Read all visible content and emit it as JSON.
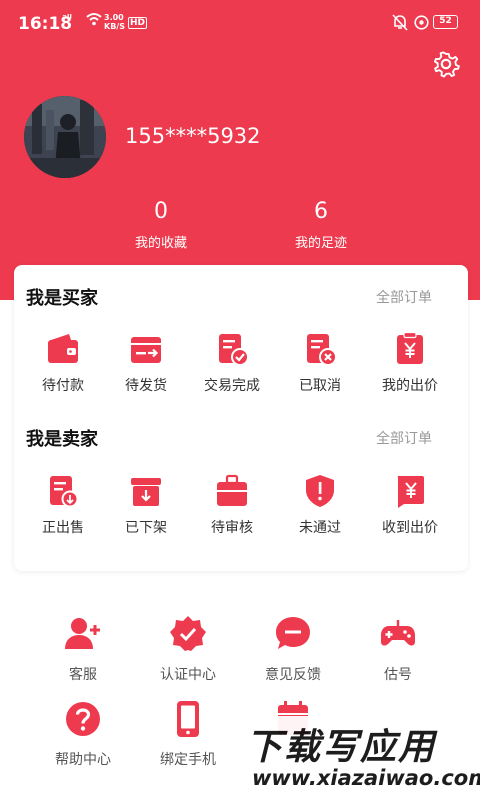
{
  "status_bar": {
    "time": "16:18",
    "signal": "ᵃˡˡ",
    "net_speed_value": "3.00",
    "net_speed_unit": "KB/S",
    "hd": "HD",
    "battery": "52"
  },
  "theme": {
    "accent": "#ee3a4e",
    "card_bg": "#ffffff",
    "muted_text": "#999999"
  },
  "profile": {
    "phone": "155****5932",
    "stats": [
      {
        "value": "0",
        "label": "我的收藏"
      },
      {
        "value": "6",
        "label": "我的足迹"
      }
    ]
  },
  "buyer": {
    "title": "我是买家",
    "all_orders": "全部订单",
    "items": [
      {
        "label": "待付款",
        "icon": "wallet-icon"
      },
      {
        "label": "待发货",
        "icon": "shipping-box-icon"
      },
      {
        "label": "交易完成",
        "icon": "document-check-icon"
      },
      {
        "label": "已取消",
        "icon": "document-cancel-icon"
      },
      {
        "label": "我的出价",
        "icon": "yen-clipboard-icon"
      }
    ]
  },
  "seller": {
    "title": "我是卖家",
    "all_orders": "全部订单",
    "items": [
      {
        "label": "正出售",
        "icon": "document-coin-icon"
      },
      {
        "label": "已下架",
        "icon": "archive-down-icon"
      },
      {
        "label": "待审核",
        "icon": "briefcase-icon"
      },
      {
        "label": "未通过",
        "icon": "shield-alert-icon"
      },
      {
        "label": "收到出价",
        "icon": "yen-tag-icon"
      }
    ]
  },
  "tools": [
    {
      "label": "客服",
      "icon": "user-add-icon"
    },
    {
      "label": "认证中心",
      "icon": "verified-badge-icon"
    },
    {
      "label": "意见反馈",
      "icon": "chat-bubble-icon"
    },
    {
      "label": "估号",
      "icon": "gamepad-icon"
    },
    {
      "label": "帮助中心",
      "icon": "help-circle-icon"
    },
    {
      "label": "绑定手机",
      "icon": "phone-icon"
    },
    {
      "label": "",
      "icon": "calendar-icon"
    }
  ],
  "watermark": {
    "title": "下载写应用",
    "url": "www.xiazaiwao.com"
  }
}
